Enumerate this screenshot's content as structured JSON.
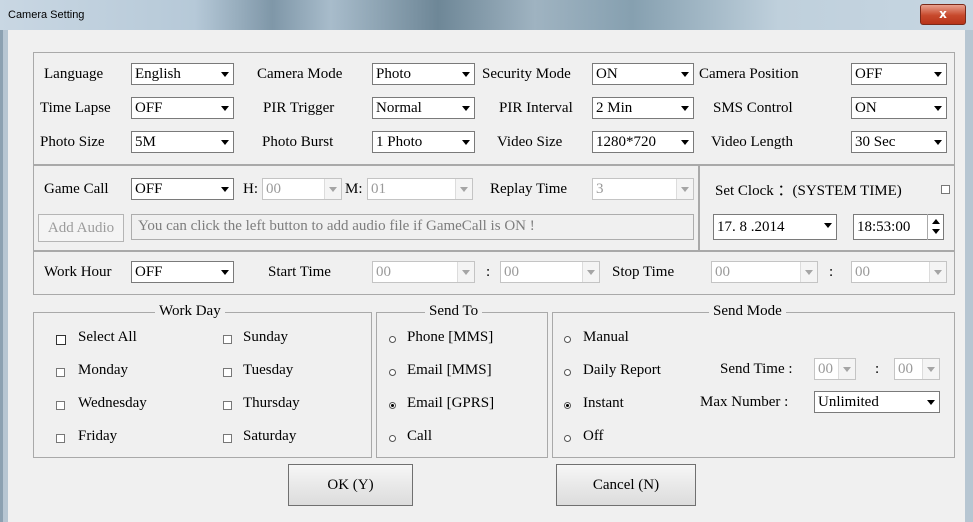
{
  "window": {
    "title": "Camera Setting",
    "close": "x"
  },
  "settings": {
    "language": {
      "label": "Language",
      "value": "English"
    },
    "camera_mode": {
      "label": "Camera Mode",
      "value": "Photo"
    },
    "security_mode": {
      "label": "Security Mode",
      "value": "ON"
    },
    "camera_position": {
      "label": "Camera Position",
      "value": "OFF"
    },
    "time_lapse": {
      "label": "Time Lapse",
      "value": "OFF"
    },
    "pir_trigger": {
      "label": "PIR Trigger",
      "value": "Normal"
    },
    "pir_interval": {
      "label": "PIR Interval",
      "value": "2  Min"
    },
    "sms_control": {
      "label": "SMS Control",
      "value": "ON"
    },
    "photo_size": {
      "label": "Photo Size",
      "value": "5M"
    },
    "photo_burst": {
      "label": "Photo Burst",
      "value": "1 Photo"
    },
    "video_size": {
      "label": "Video Size",
      "value": "1280*720"
    },
    "video_length": {
      "label": "Video Length",
      "value": "30  Sec"
    }
  },
  "gamecall": {
    "label": "Game Call",
    "value": "OFF",
    "h_label": "H:",
    "h_value": "00",
    "m_label": "M:",
    "m_value": "01",
    "replay_label": "Replay Time",
    "replay_value": "3",
    "add_audio": "Add Audio",
    "hint": "You can click the left button to add audio file if GameCall is ON !"
  },
  "clock": {
    "label": "Set Clock ：(SYSTEM TIME)",
    "date": "17. 8 .2014",
    "time": "18:53:00"
  },
  "workhour": {
    "label": "Work Hour",
    "value": "OFF",
    "start_label": "Start Time",
    "start_h": "00",
    "start_m": "00",
    "sep": ":",
    "stop_label": "Stop Time",
    "stop_h": "00",
    "stop_m": "00"
  },
  "workday": {
    "title": "Work Day",
    "select_all": "Select All",
    "days": [
      "Sunday",
      "Monday",
      "Tuesday",
      "Wednesday",
      "Thursday",
      "Friday",
      "Saturday"
    ]
  },
  "sendto": {
    "title": "Send To",
    "options": [
      "Phone [MMS]",
      "Email [MMS]",
      "Email [GPRS]",
      "Call"
    ],
    "selected": "Email [GPRS]"
  },
  "sendmode": {
    "title": "Send Mode",
    "options": [
      "Manual",
      "Daily Report",
      "Instant",
      "Off"
    ],
    "selected": "Instant",
    "send_time_label": "Send Time :",
    "send_h": "00",
    "send_m": "00",
    "sep": ":",
    "max_label": "Max Number :",
    "max_value": "Unlimited"
  },
  "buttons": {
    "ok": "OK (Y)",
    "cancel": "Cancel (N)"
  }
}
